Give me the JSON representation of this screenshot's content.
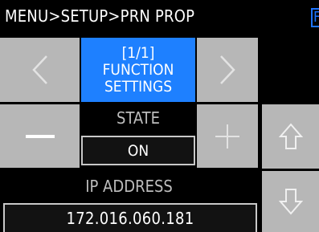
{
  "header": {
    "title": "MENU>SETUP>PRN PROP",
    "corner_tag": "F"
  },
  "nav": {
    "prev_icon": "chevron-left-icon",
    "next_icon": "chevron-right-icon",
    "page": "[1/1]",
    "function_line1": "FUNCTION",
    "function_line2": "SETTINGS"
  },
  "state": {
    "label": "STATE",
    "value": "ON"
  },
  "ip": {
    "label": "IP ADDRESS",
    "value": "172.016.060.181"
  },
  "controls": {
    "minus_icon": "minus-icon",
    "plus_icon": "plus-icon",
    "up_icon": "arrow-up-outline-icon",
    "down_icon": "arrow-down-outline-icon"
  },
  "colors": {
    "background": "#000000",
    "button_gray": "#b7b7b7",
    "accent_blue": "#1e80ff",
    "label_gray": "#bdbdbd",
    "value_border": "#c8c8c8"
  }
}
